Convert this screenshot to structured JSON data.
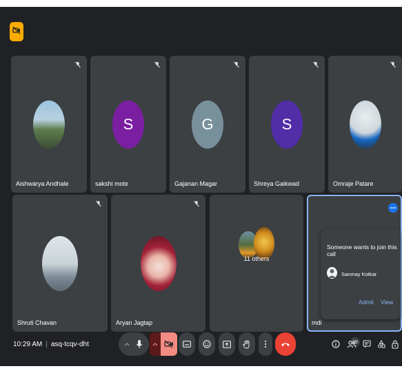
{
  "top_badge": {
    "icon": "no-video-icon",
    "color": "#f9ab00"
  },
  "participants_row1": [
    {
      "name": "Aishwarya Andhale",
      "avatar": "photo"
    },
    {
      "name": "sakshi mote",
      "initial": "S",
      "color": "#7b1fa2"
    },
    {
      "name": "Gajanan Magar",
      "initial": "G",
      "color": "#78909c"
    },
    {
      "name": "Shreya Gaikwad",
      "initial": "S",
      "color": "#512da8"
    },
    {
      "name": "Omraje Patare",
      "avatar": "photo"
    }
  ],
  "participants_row2": [
    {
      "name": "Shruti Chavan",
      "avatar": "photo"
    },
    {
      "name": "Aryan Jagtap",
      "avatar": "photo"
    },
    {
      "name": "11 others",
      "avatar": "group"
    },
    {
      "name": "mdi"
    }
  ],
  "join_request": {
    "title": "Someone wants to join this call",
    "requester": "Sanmay Kotkar",
    "admit_label": "Admit",
    "view_label": "View"
  },
  "meeting": {
    "time": "10:29 AM",
    "separator": "|",
    "code": "asq-tcqv-dht"
  },
  "people_count": "19",
  "colors": {
    "background": "#202124",
    "tile": "#3c4043",
    "accent": "#8ab4f8",
    "end_call": "#ea4335",
    "camera_off": "#f28b82"
  }
}
